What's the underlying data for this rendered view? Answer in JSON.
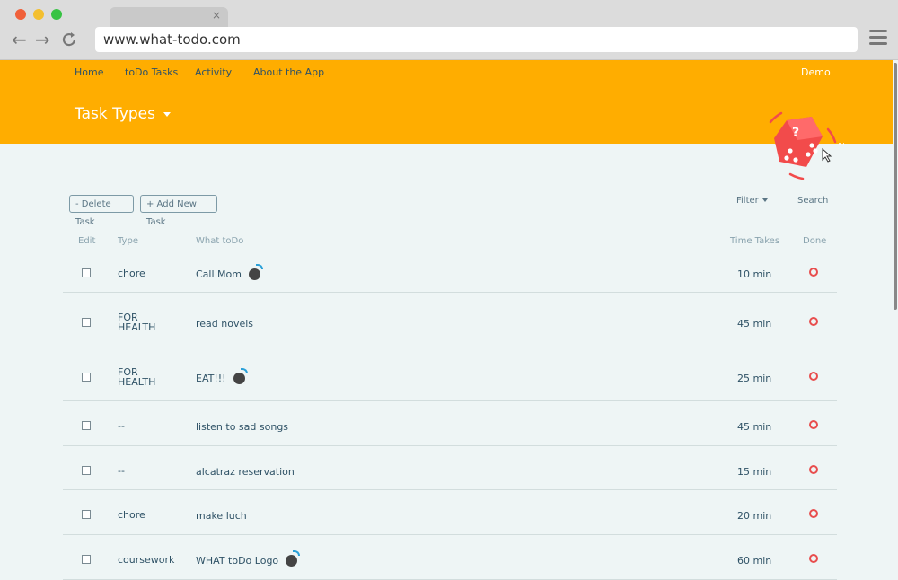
{
  "browser": {
    "url": "www.what-todo.com",
    "tab_close": "×",
    "back": "←",
    "forward": "→",
    "reload": "C"
  },
  "nav": {
    "home": "Home",
    "todo_tasks": "toDo Tasks",
    "activity": "Activity",
    "about": "About the App",
    "demo": "Demo"
  },
  "page_title": "Task Types",
  "toolbar": {
    "delete_label": "- Delete Task",
    "add_label": "+ Add New Task",
    "filter_label": "Filter",
    "search_label": "Search"
  },
  "table": {
    "headers": {
      "edit": "Edit",
      "type": "Type",
      "what": "What toDo",
      "time": "Time Takes",
      "done": "Done"
    },
    "rows": [
      {
        "type": "chore",
        "what": "Call Mom",
        "time": "10 min",
        "bomb": true
      },
      {
        "type": "FOR HEALTH",
        "what": "read novels",
        "time": "45 min",
        "bomb": false
      },
      {
        "type": "FOR HEALTH",
        "what": "EAT!!!",
        "time": "25 min",
        "bomb": true
      },
      {
        "type": "--",
        "what": "listen to sad songs",
        "time": "45 min",
        "bomb": false
      },
      {
        "type": "--",
        "what": "alcatraz reservation",
        "time": "15 min",
        "bomb": false
      },
      {
        "type": "chore",
        "what": "make luch",
        "time": "20 min",
        "bomb": false
      },
      {
        "type": "coursework",
        "what": "WHAT toDo Logo",
        "time": "60 min",
        "bomb": true
      }
    ]
  },
  "colors": {
    "header": "#ffad00",
    "done_ring": "#e84d4d",
    "dice": "#f24b4b"
  }
}
